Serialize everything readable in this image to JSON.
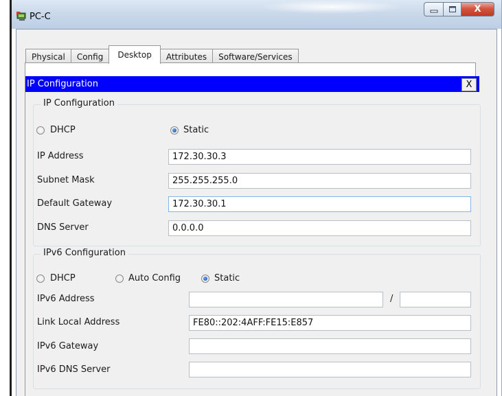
{
  "window": {
    "title": "PC-C",
    "close_glyph": "X",
    "icons": [
      "pc-icon",
      "minimize-icon",
      "maximize-icon",
      "close-icon"
    ]
  },
  "tabs": [
    {
      "label": "Physical",
      "active": false
    },
    {
      "label": "Config",
      "active": false
    },
    {
      "label": "Desktop",
      "active": true
    },
    {
      "label": "Attributes",
      "active": false
    },
    {
      "label": "Software/Services",
      "active": false
    }
  ],
  "ip_config": {
    "header_title": "IP Configuration",
    "close_label": "X",
    "ipv4": {
      "group_label": "IP Configuration",
      "dhcp_label": "DHCP",
      "static_label": "Static",
      "selected_mode": "Static",
      "ip_address_label": "IP Address",
      "ip_address": "172.30.30.3",
      "subnet_mask_label": "Subnet Mask",
      "subnet_mask": "255.255.255.0",
      "default_gateway_label": "Default Gateway",
      "default_gateway": "172.30.30.1",
      "dns_server_label": "DNS Server",
      "dns_server": "0.0.0.0"
    },
    "ipv6": {
      "group_label": "IPv6 Configuration",
      "dhcp_label": "DHCP",
      "auto_config_label": "Auto Config",
      "static_label": "Static",
      "selected_mode": "Static",
      "address_label": "IPv6 Address",
      "address": "",
      "prefix_separator": "/",
      "prefix_length": "",
      "link_local_label": "Link Local Address",
      "link_local": "FE80::202:4AFF:FE15:E857",
      "gateway_label": "IPv6 Gateway",
      "gateway": "",
      "dns_server_label": "IPv6 DNS Server",
      "dns_server": ""
    }
  },
  "colors": {
    "header_bar": "#0000ff",
    "titlebar": "#cad9ea",
    "close_button": "#c13a23",
    "focus_border": "#7eb4ea"
  }
}
